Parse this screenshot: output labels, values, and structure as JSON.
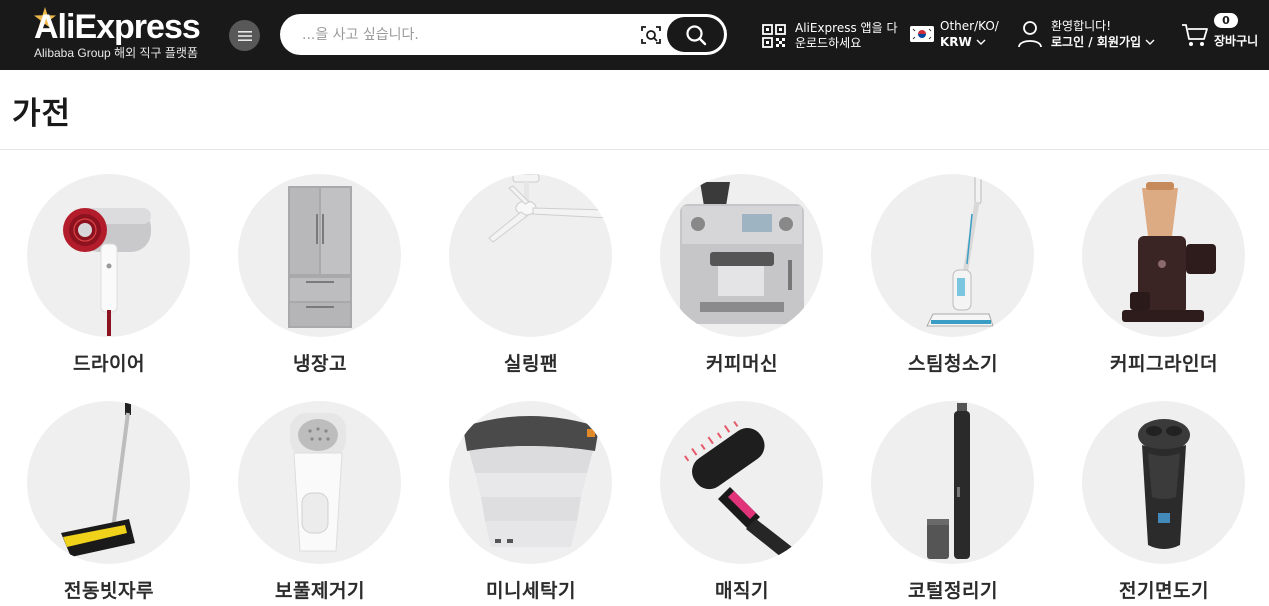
{
  "header": {
    "logo_text": "AliExpress",
    "logo_tagline": "Alibaba Group 해외 직구 플랫폼",
    "search_placeholder": "...을 사고 싶습니다.",
    "app_download_line1": "AliExpress 앱을 다",
    "app_download_line2": "운로드하세요",
    "locale_line1": "Other/KO/",
    "locale_line2": "KRW",
    "account_line1": "환영합니다!",
    "account_line2": "로그인 / 회원가입",
    "cart_count": "0",
    "cart_label": "장바구니",
    "colors": {
      "header_bg": "#191919",
      "logo_accent": "#f0b84a"
    }
  },
  "page": {
    "title": "가전"
  },
  "categories": [
    {
      "label": "드라이어",
      "icon": "hair-dryer"
    },
    {
      "label": "냉장고",
      "icon": "refrigerator"
    },
    {
      "label": "실링팬",
      "icon": "ceiling-fan"
    },
    {
      "label": "커피머신",
      "icon": "espresso-machine"
    },
    {
      "label": "스팀청소기",
      "icon": "steam-mop"
    },
    {
      "label": "커피그라인더",
      "icon": "coffee-grinder"
    },
    {
      "label": "전동빗자루",
      "icon": "electric-broom"
    },
    {
      "label": "보풀제거기",
      "icon": "lint-remover"
    },
    {
      "label": "미니세탁기",
      "icon": "mini-washer"
    },
    {
      "label": "매직기",
      "icon": "hot-air-brush"
    },
    {
      "label": "코털정리기",
      "icon": "nose-trimmer"
    },
    {
      "label": "전기면도기",
      "icon": "electric-shaver"
    }
  ]
}
